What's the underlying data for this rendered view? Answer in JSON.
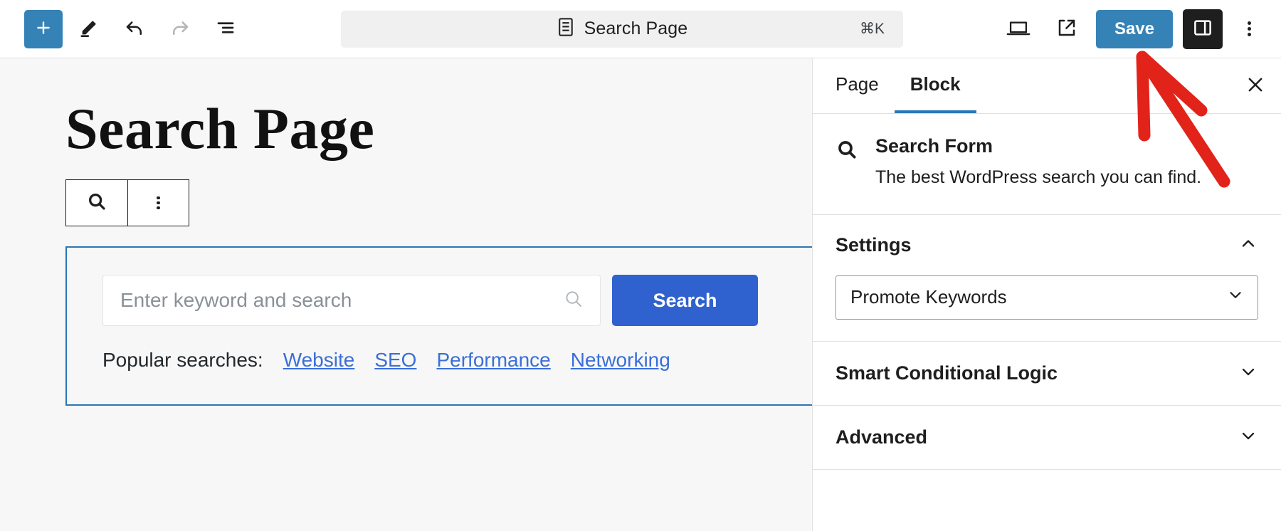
{
  "header": {
    "add_block_label": "+",
    "tools": [
      {
        "name": "add-block-button",
        "icon": "plus-icon"
      },
      {
        "name": "tools-pencil-button",
        "icon": "pencil-icon"
      },
      {
        "name": "undo-button",
        "icon": "undo-icon"
      },
      {
        "name": "redo-button",
        "icon": "redo-icon"
      },
      {
        "name": "list-view-button",
        "icon": "list-view-icon"
      }
    ],
    "command_bar": {
      "title": "Search Page",
      "shortcut": "⌘K",
      "icon": "page-icon"
    },
    "view_icon": "desktop-icon",
    "preview_icon": "external-link-icon",
    "save_label": "Save",
    "sidebar_toggle_icon": "sidebar-panel-icon",
    "options_icon": "kebab-menu-icon"
  },
  "canvas": {
    "page_title": "Search Page",
    "block_toolbar": {
      "search_icon": "search-icon",
      "options_icon": "vertical-dots-icon"
    },
    "search_form": {
      "input_placeholder": "Enter keyword and search",
      "input_value": "",
      "input_icon": "search-icon",
      "submit_label": "Search",
      "popular_label": "Popular searches:",
      "popular_links": [
        "Website",
        "SEO",
        "Performance",
        "Networking"
      ]
    }
  },
  "sidebar": {
    "tabs": [
      {
        "label": "Page",
        "active": false
      },
      {
        "label": "Block",
        "active": true
      }
    ],
    "close_icon": "close-icon",
    "block_info": {
      "icon": "search-icon",
      "name": "Search Form",
      "description": "The best WordPress search you can find."
    },
    "panels": [
      {
        "title": "Settings",
        "expanded": true,
        "chevron": "chevron-up-icon",
        "select": {
          "value": "Promote Keywords",
          "chevron": "chevron-down-icon"
        }
      },
      {
        "title": "Smart Conditional Logic",
        "expanded": false,
        "chevron": "chevron-down-icon"
      },
      {
        "title": "Advanced",
        "expanded": false,
        "chevron": "chevron-down-icon"
      }
    ]
  },
  "colors": {
    "accent_blue": "#3582b7",
    "button_blue": "#2f62cf",
    "link_blue": "#3a6fd8",
    "annotation_red": "#e2231a",
    "dark": "#1e1e1e"
  }
}
